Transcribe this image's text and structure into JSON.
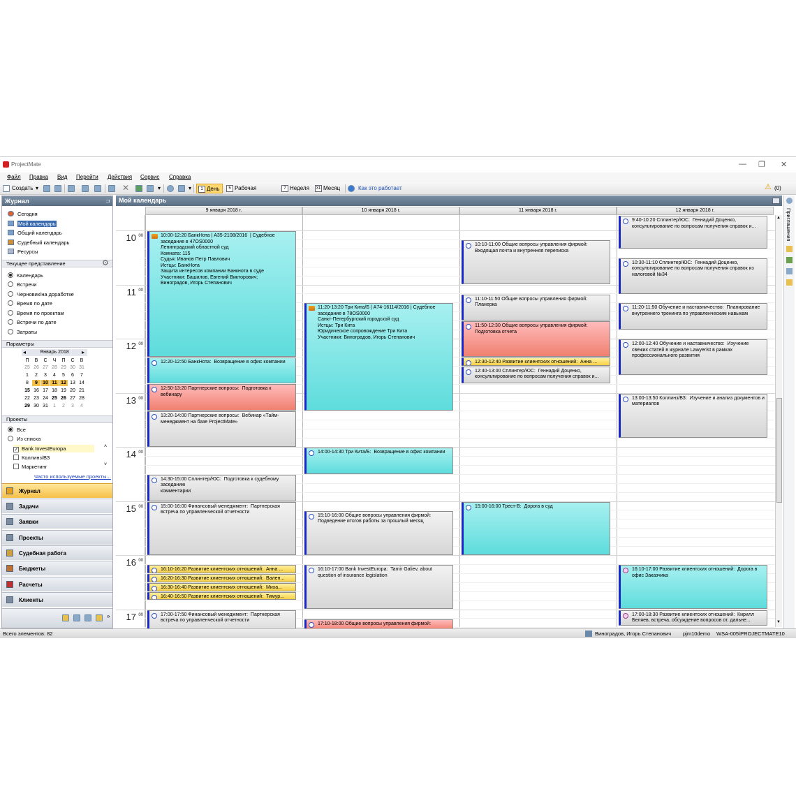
{
  "window": {
    "title": "ProjectMate",
    "controls": [
      "—",
      "❐",
      "✕"
    ]
  },
  "menu": [
    "Файл",
    "Правка",
    "Вид",
    "Перейти",
    "Действия",
    "Сервис",
    "Справка"
  ],
  "toolbar": {
    "create": "Создать",
    "views": [
      {
        "icon": "1",
        "label": "День",
        "active": true
      },
      {
        "icon": "5",
        "label": "Рабочая неделя",
        "active": false
      },
      {
        "icon": "7",
        "label": "Неделя",
        "active": false
      },
      {
        "icon": "31",
        "label": "Месяц",
        "active": false
      }
    ],
    "help": "Как это работает",
    "warnings": "(0)"
  },
  "left": {
    "journal_title": "Журнал",
    "nav": [
      "Сегодня",
      "Мой календарь",
      "Общий календарь",
      "Судебный календарь",
      "Ресурсы"
    ],
    "current_view_title": "Текущее представление",
    "views": [
      "Календарь",
      "Встречи",
      "Черновик/на доработке",
      "Время по дате",
      "Время по проектам",
      "Встречи по дате",
      "Затраты"
    ],
    "params_title": "Параметры",
    "month": {
      "title": "Январь 2018",
      "weekdays": [
        "П",
        "В",
        "С",
        "Ч",
        "П",
        "С",
        "В"
      ],
      "weeks": [
        [
          "25",
          "26",
          "27",
          "28",
          "29",
          "30",
          "31"
        ],
        [
          "1",
          "2",
          "3",
          "4",
          "5",
          "6",
          "7"
        ],
        [
          "8",
          "9",
          "10",
          "11",
          "12",
          "13",
          "14"
        ],
        [
          "15",
          "16",
          "17",
          "18",
          "19",
          "20",
          "21"
        ],
        [
          "22",
          "23",
          "24",
          "25",
          "26",
          "27",
          "28"
        ],
        [
          "29",
          "30",
          "31",
          "1",
          "2",
          "3",
          "4"
        ]
      ]
    },
    "projects_title": "Проекты",
    "project_filters": [
      "Все",
      "Из списка"
    ],
    "projects": [
      "Bank InvestEuropa",
      "Коллинз/ВЗ",
      "Маркетинг"
    ],
    "frequent_link": "Часто используемые проекты...",
    "sections": [
      "Журнал",
      "Задачи",
      "Заявки",
      "Проекты",
      "Судебная работа",
      "Бюджеты",
      "Расчеты",
      "Клиенты"
    ]
  },
  "calendar": {
    "title": "Мой календарь",
    "days": [
      "9 января 2018 г.",
      "10 января 2018 г.",
      "11 января 2018 г.",
      "12 января 2018 г."
    ],
    "hours": [
      "10",
      "11",
      "12",
      "13",
      "14",
      "15",
      "16",
      "17"
    ],
    "minutes": "00",
    "appointments": [
      {
        "day": 0,
        "start": 10.0,
        "end": 12.33,
        "color": "cyan",
        "icon": "court",
        "text": "10:00-12:20 БанкНота | А35-2108/2016  | Судебное заседание в 47OS0000\nЛенинградский областной суд\nКомната: 115\nСудья: Иванов Петр Павлович\nИстцы: БанкНота\nЗащита интересов компании Банкнота в суде\nУчастники: Башилов, Евгений Викторович;\nВиноградов, Игорь Степанович"
      },
      {
        "day": 0,
        "start": 12.33,
        "end": 12.83,
        "color": "cyan",
        "icon": "clock",
        "text": "12:20-12:50 БанкНота:  Возвращение в офис компании"
      },
      {
        "day": 0,
        "start": 12.83,
        "end": 13.33,
        "color": "red",
        "icon": "clock",
        "text": "12:50-13:20 Партнерские вопросы:  Подготовка к вебинару"
      },
      {
        "day": 0,
        "start": 13.33,
        "end": 14.0,
        "color": "gray",
        "icon": "clock",
        "text": "13:20-14:00 Партнерские вопросы:  Вебинар «Тайм-менеджмент на базе ProjectMate»"
      },
      {
        "day": 0,
        "start": 14.5,
        "end": 15.0,
        "color": "gray",
        "icon": "clock",
        "text": "14:30-15:00 Сплинтер/ЮС:  Подготовка к судебному заседанию\nкомментарии"
      },
      {
        "day": 0,
        "start": 15.0,
        "end": 16.0,
        "color": "gray",
        "icon": "clock",
        "text": "15:00-16:00 Финансовый менеджмент:  Партнерская встреча по управленческой отчетности"
      },
      {
        "day": 0,
        "start": 16.17,
        "end": 16.33,
        "color": "yellow",
        "icon": "clock",
        "text": "16:10-16:20 Развитие клиентских отношений:  Анна ..."
      },
      {
        "day": 0,
        "start": 16.33,
        "end": 16.5,
        "color": "yellow",
        "icon": "clock",
        "text": "16:20-16:30 Развитие клиентских отношений:  Вален..."
      },
      {
        "day": 0,
        "start": 16.5,
        "end": 16.67,
        "color": "yellow",
        "icon": "clock",
        "text": "16:30-16:40 Развитие клиентских отношений:  Миха..."
      },
      {
        "day": 0,
        "start": 16.67,
        "end": 16.83,
        "color": "yellow",
        "icon": "clock",
        "text": "16:40-16:50 Развитие клиентских отношений:  Тимур..."
      },
      {
        "day": 0,
        "start": 17.0,
        "end": 17.5,
        "color": "gray",
        "icon": "clock",
        "text": "17:00-17:50 Финансовый менеджмент:  Партнерская встреча по управленческой отчетности"
      },
      {
        "day": 1,
        "start": 11.33,
        "end": 13.33,
        "color": "cyan",
        "icon": "court",
        "text": "11:20-13:20 Три Кита/Б | А74-16114/2016 | Судебное заседание в 78OS0000\nСанкт-Петербургский городской суд\nИстцы: Три Кита\nЮридическое сопровождение Три Кита\nУчастники: Виноградов, Игорь Степанович"
      },
      {
        "day": 1,
        "start": 14.0,
        "end": 14.5,
        "color": "cyan",
        "icon": "clock",
        "text": "14:00-14:30 Три Кита/Б:  Возвращение в офис компании"
      },
      {
        "day": 1,
        "start": 15.17,
        "end": 16.0,
        "color": "gray",
        "icon": "clock",
        "text": "15:10-16:00 Общие вопросы управления фирмой:  Подведение итогов работы за прошлый месяц"
      },
      {
        "day": 1,
        "start": 16.17,
        "end": 17.0,
        "color": "gray",
        "icon": "clock",
        "text": "16:10-17:00 Bank InvestEuropa:  Tamir Galiev, about question of insurance legislation"
      },
      {
        "day": 1,
        "start": 17.17,
        "end": 17.4,
        "color": "red",
        "icon": "clock",
        "text": "17:10-18:00 Общие вопросы управления фирмой:"
      },
      {
        "day": 2,
        "start": 10.17,
        "end": 11.0,
        "color": "gray",
        "icon": "clock",
        "text": "10:10-11:00 Общие вопросы управления фирмой:  Входящая почта и внутренняя переписка"
      },
      {
        "day": 2,
        "start": 11.17,
        "end": 11.67,
        "color": "gray",
        "icon": "clock",
        "text": "11:10-11:50 Общие вопросы управления фирмой:  Планерка"
      },
      {
        "day": 2,
        "start": 11.67,
        "end": 12.33,
        "color": "red",
        "icon": "clock",
        "text": "11:50-12:30 Общие вопросы управления фирмой:  Подготовка отчета"
      },
      {
        "day": 2,
        "start": 12.33,
        "end": 12.5,
        "color": "yellow",
        "icon": "clock",
        "text": "12:30-12:40 Развитие клиентских отношений:  Анна ..."
      },
      {
        "day": 2,
        "start": 12.5,
        "end": 12.83,
        "color": "gray",
        "icon": "clock",
        "text": "12:40-13:00 Сплинтер/ЮС:  Геннадий Доценко, консультирование по вопросам получения справок и..."
      },
      {
        "day": 2,
        "start": 15.0,
        "end": 16.0,
        "color": "cyan",
        "icon": "clock",
        "text": "15:00-16:00 Трест-В:  Дорога в суд"
      },
      {
        "day": 3,
        "start": 9.67,
        "end": 10.33,
        "color": "gray",
        "icon": "clock",
        "text": "9:40-10:20 Сплинтер/ЮС:  Геннадий Доценко, консультирование по вопросам получения справок и..."
      },
      {
        "day": 3,
        "start": 10.5,
        "end": 11.17,
        "color": "gray",
        "icon": "clock",
        "text": "10:30-11:10 Сплинтер/ЮС:  Геннадий Доценко, консультирование по вопросам получения справок из налоговой №34"
      },
      {
        "day": 3,
        "start": 11.33,
        "end": 11.83,
        "color": "gray",
        "icon": "clock",
        "text": "11:20-11:50 Обучение и наставничество:  Планирование внутреннего тренинга по управленческим навыкам"
      },
      {
        "day": 3,
        "start": 12.0,
        "end": 12.67,
        "color": "gray",
        "icon": "clock",
        "text": "12:00-12:40 Обучение и наставничество:  Изучение свежих статей в журнале Lawyerist в рамках профессионального развития"
      },
      {
        "day": 3,
        "start": 13.0,
        "end": 13.83,
        "color": "gray",
        "icon": "clock",
        "text": "13:00-13:50 Коллинз/ВЗ:  Изучение и анализ документов и материалов"
      },
      {
        "day": 3,
        "start": 16.17,
        "end": 17.0,
        "color": "cyan",
        "icon": "road",
        "text": "16:10-17:00 Развитие клиентских отношений:  Дорога в офис Заказчика"
      },
      {
        "day": 3,
        "start": 17.0,
        "end": 17.3,
        "color": "gray",
        "icon": "road",
        "text": "17:00-18:30 Развитие клиентских отношений:  Кирилл Беляев, встреча, обсуждение вопросов от. дальне..."
      }
    ]
  },
  "right_rail_label": "Приглашения",
  "status": {
    "count": "Всего элементов: 82",
    "user": "Виноградов, Игорь Степанович",
    "db": "pjm10demo",
    "server": "WSA-005\\PROJECTMATE10"
  },
  "colors": {
    "accent_blue": "#1826c8",
    "cyan": "#5edcdc",
    "red": "#f08070",
    "yellow": "#f6d044",
    "header": "#6a7e94"
  }
}
